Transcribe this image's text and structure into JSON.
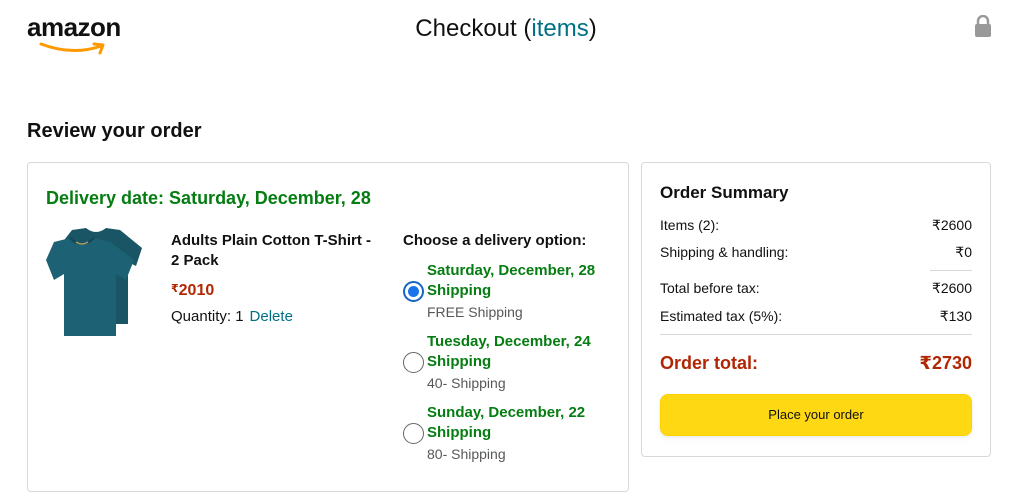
{
  "header": {
    "logo_text": "amazon",
    "title_prefix": "Checkout (",
    "title_link": "items",
    "title_suffix": ")",
    "lock_icon": "lock-icon"
  },
  "review": {
    "heading": "Review your order"
  },
  "order": {
    "delivery_date": "Delivery date: Saturday, December, 28",
    "product": {
      "name": "Adults Plain Cotton T-Shirt - 2 Pack",
      "currency_symbol": "₹",
      "price": "2010",
      "quantity_label": "Quantity: 1",
      "delete_label": "Delete",
      "image_color": "#1d5f6e"
    },
    "delivery_heading": "Choose a delivery option:",
    "options": [
      {
        "date": "Saturday, December, 28",
        "type": "Shipping",
        "cost": "FREE Shipping",
        "selected": true
      },
      {
        "date": "Tuesday, December, 24",
        "type": "Shipping",
        "cost": "40- Shipping",
        "selected": false
      },
      {
        "date": "Sunday, December, 22",
        "type": "Shipping",
        "cost": "80- Shipping",
        "selected": false
      }
    ]
  },
  "summary": {
    "heading": "Order Summary",
    "items_label": "Items (2):",
    "items_value": "₹2600",
    "shipping_label": "Shipping & handling:",
    "shipping_value": "₹0",
    "before_tax_label": "Total before tax:",
    "before_tax_value": "₹2600",
    "tax_label": "Estimated tax (5%):",
    "tax_value": "₹130",
    "total_label": "Order total:",
    "total_value": "₹2730",
    "place_order_label": "Place your order"
  },
  "colors": {
    "green": "#067d12",
    "price_red": "#b12704",
    "link_teal": "#007185",
    "button_yellow": "#ffd814",
    "radio_blue": "#1a73e8"
  }
}
